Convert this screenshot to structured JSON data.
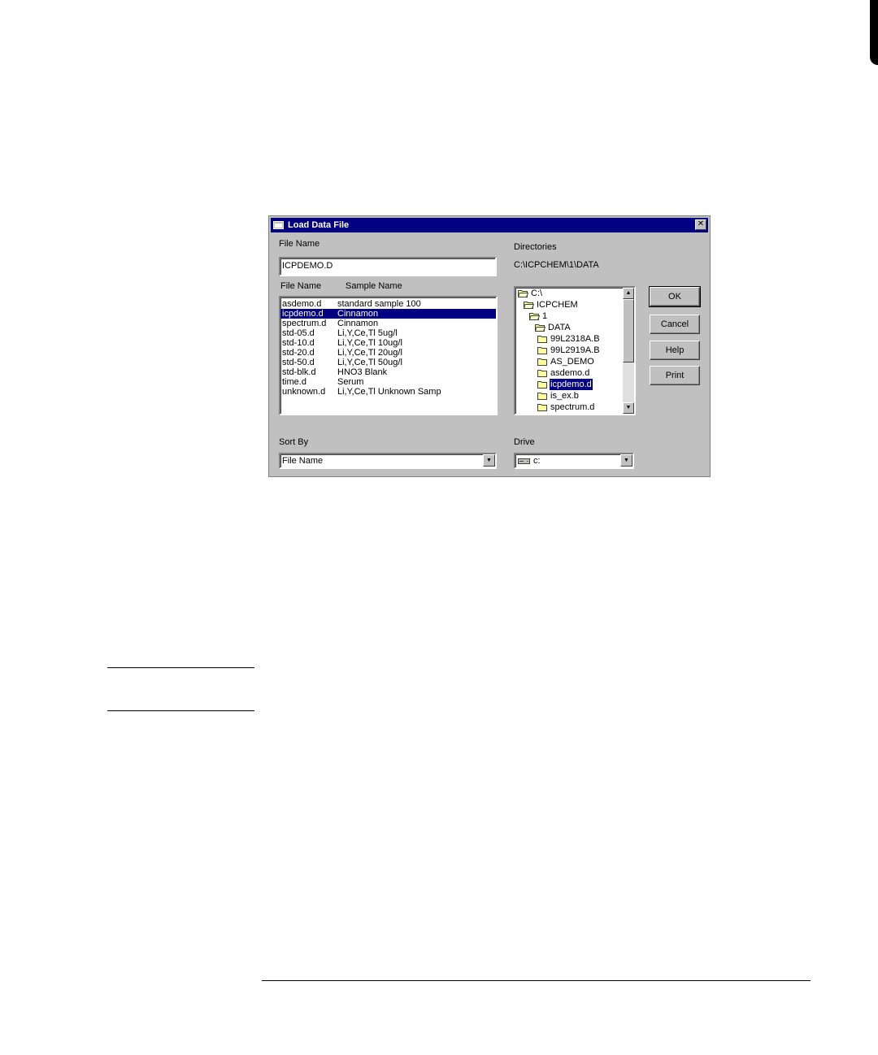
{
  "dialog": {
    "title": "Load Data File",
    "close_glyph": "✕",
    "file_name_label": "File Name",
    "file_name_value": "ICPDEMO.D",
    "list_header_file": "File Name",
    "list_header_sample": "Sample Name",
    "files": [
      {
        "file": "asdemo.d",
        "sample": "standard sample 100"
      },
      {
        "file": "icpdemo.d",
        "sample": "Cinnamon",
        "selected": true
      },
      {
        "file": "spectrum.d",
        "sample": "Cinnamon"
      },
      {
        "file": "std-05.d",
        "sample": "Li,Y,Ce,Tl 5ug/l"
      },
      {
        "file": "std-10.d",
        "sample": "Li,Y,Ce,Tl 10ug/l"
      },
      {
        "file": "std-20.d",
        "sample": "Li,Y,Ce,Tl 20ug/l"
      },
      {
        "file": "std-50.d",
        "sample": "Li,Y,Ce,Tl 50ug/l"
      },
      {
        "file": "std-blk.d",
        "sample": "HNO3 Blank"
      },
      {
        "file": "time.d",
        "sample": "Serum"
      },
      {
        "file": "unknown.d",
        "sample": "Li,Y,Ce,Tl Unknown Samp"
      }
    ],
    "directories_label": "Directories",
    "current_path": "C:\\ICPCHEM\\1\\DATA",
    "tree": [
      {
        "label": "C:\\",
        "level": 0,
        "open": true
      },
      {
        "label": "ICPCHEM",
        "level": 1,
        "open": true
      },
      {
        "label": "1",
        "level": 2,
        "open": true
      },
      {
        "label": "DATA",
        "level": 3,
        "open": true
      },
      {
        "label": "99L2318A.B",
        "level": 4
      },
      {
        "label": "99L2919A.B",
        "level": 4
      },
      {
        "label": "AS_DEMO",
        "level": 4
      },
      {
        "label": "asdemo.d",
        "level": 4
      },
      {
        "label": "icpdemo.d",
        "level": 4,
        "selected": true
      },
      {
        "label": "is_ex.b",
        "level": 4
      },
      {
        "label": "spectrum.d",
        "level": 4
      }
    ],
    "buttons": {
      "ok": "OK",
      "cancel": "Cancel",
      "help": "Help",
      "print": "Print"
    },
    "sort_by_label": "Sort By",
    "sort_by_value": "File Name",
    "drive_label": "Drive",
    "drive_value": "c:"
  },
  "colors": {
    "title_bar": "#000080",
    "selection": "#000080",
    "dialog_face": "#c0c0c0"
  },
  "icons": [
    "dialog-folder-icon",
    "folder-icon",
    "open-folder-icon",
    "drive-icon",
    "scroll-up-arrow",
    "scroll-down-arrow",
    "dropdown-arrow"
  ]
}
